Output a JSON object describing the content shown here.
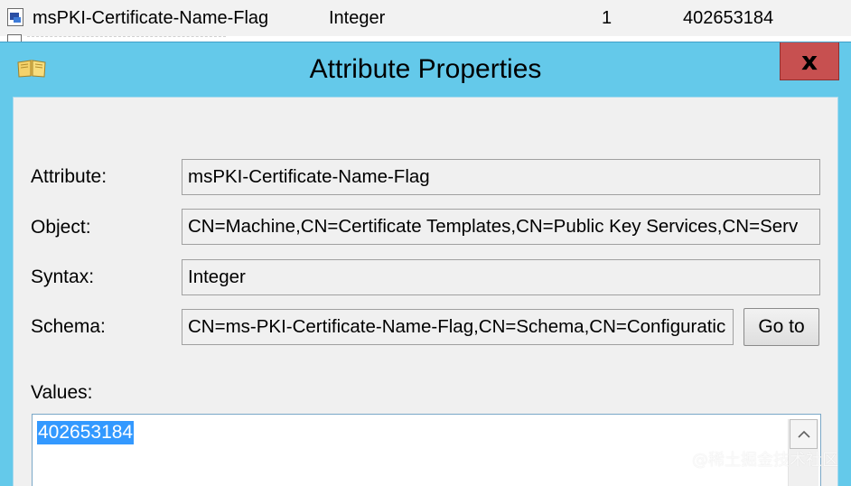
{
  "background_list": {
    "row": {
      "icon": "attribute-icon",
      "name": "msPKI-Certificate-Name-Flag",
      "syntax": "Integer",
      "count": "1",
      "value": "402653184"
    }
  },
  "dialog": {
    "title": "Attribute Properties",
    "title_icon": "open-book-icon",
    "close_label": "x",
    "colors": {
      "frame": "#64c9ea",
      "close_button": "#c75050",
      "client_background": "#f0f0f0",
      "selection": "#3399ff"
    }
  },
  "form": {
    "attribute": {
      "label": "Attribute:",
      "value": "msPKI-Certificate-Name-Flag"
    },
    "object": {
      "label": "Object:",
      "value": "CN=Machine,CN=Certificate Templates,CN=Public Key Services,CN=Serv"
    },
    "syntax": {
      "label": "Syntax:",
      "value": "Integer"
    },
    "schema": {
      "label": "Schema:",
      "value": "CN=ms-PKI-Certificate-Name-Flag,CN=Schema,CN=Configuratic",
      "goto_label": "Go to"
    },
    "values": {
      "label": "Values:",
      "items": [
        "402653184"
      ],
      "selected_index": 0,
      "scroll_up_icon": "chevron-up-icon"
    }
  },
  "watermark": "@稀土掘金技术社区"
}
